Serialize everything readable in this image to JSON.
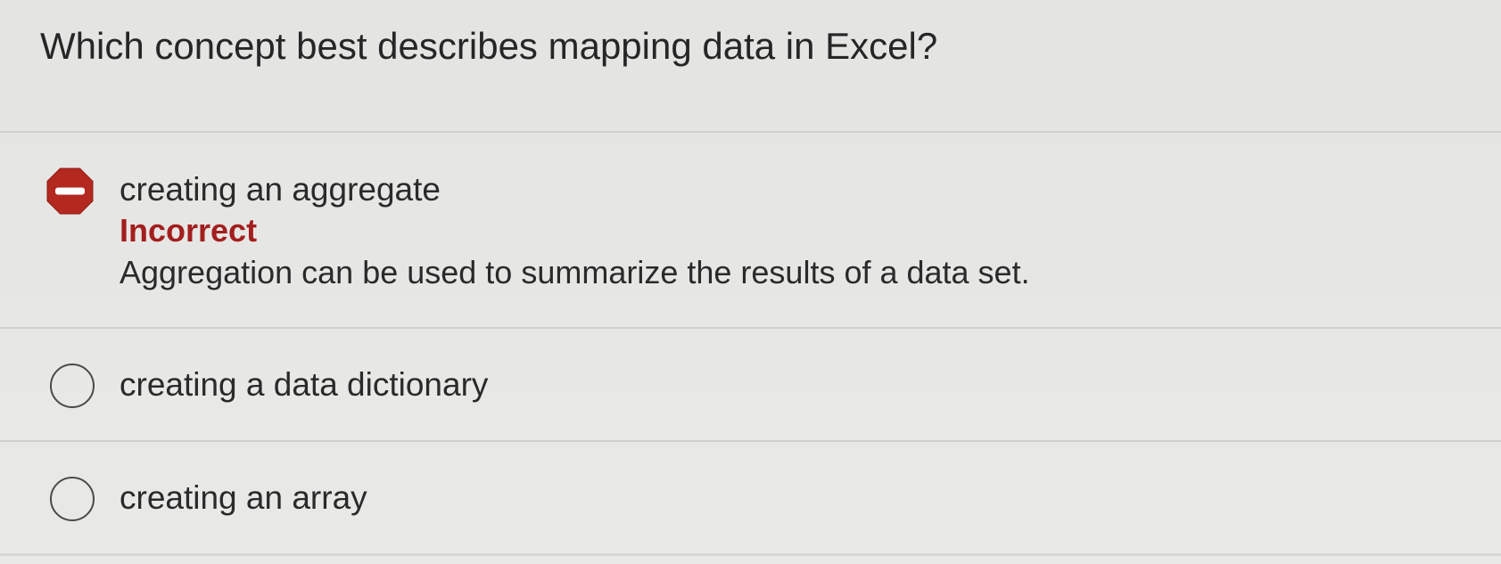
{
  "question": {
    "text": "Which concept best describes mapping data in Excel?"
  },
  "options": [
    {
      "label": "creating an aggregate",
      "selected": true,
      "status": "Incorrect",
      "feedback": "Aggregation can be used to summarize the results of a data set.",
      "icon": "no-entry-icon"
    },
    {
      "label": "creating a data dictionary",
      "selected": false,
      "icon": "radio-empty-icon"
    },
    {
      "label": "creating an array",
      "selected": false,
      "icon": "radio-empty-icon"
    }
  ],
  "colors": {
    "incorrect": "#a31e1e",
    "stop_icon": "#b3281f"
  }
}
